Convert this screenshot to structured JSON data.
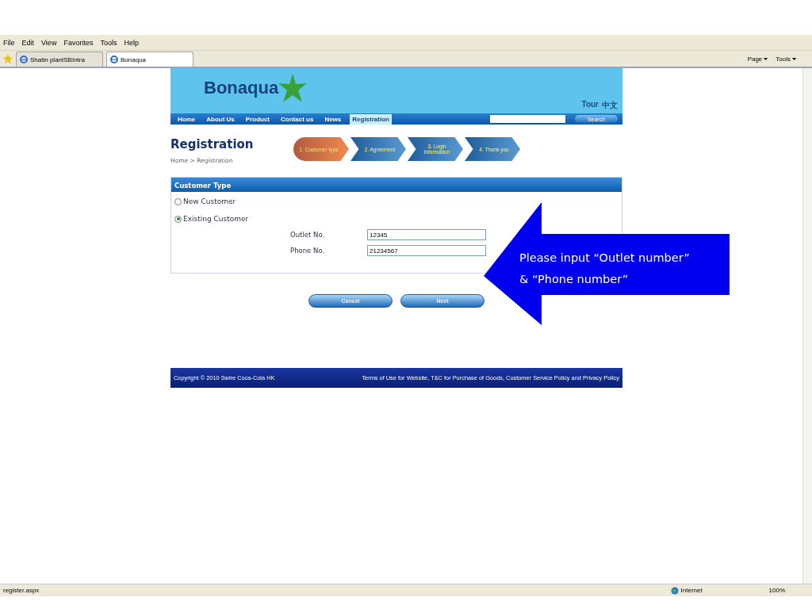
{
  "browser": {
    "menu": [
      "File",
      "Edit",
      "View",
      "Favorites",
      "Tools",
      "Help"
    ],
    "tabs": [
      {
        "label": "Shatin plantSBIntra",
        "selected": false
      },
      {
        "label": "Bonaqua",
        "selected": true
      }
    ],
    "tools": [
      "Page",
      "Tools"
    ]
  },
  "site": {
    "logo": "Bonaqua",
    "header_links": [
      "Tour",
      "中文"
    ],
    "nav": [
      {
        "label": "Home",
        "selected": false
      },
      {
        "label": "About Us",
        "selected": false
      },
      {
        "label": "Product",
        "selected": false
      },
      {
        "label": "Contact us",
        "selected": false
      },
      {
        "label": "News",
        "selected": false
      },
      {
        "label": "Registration",
        "selected": true
      }
    ],
    "search_button": "Search",
    "title": "Registration",
    "breadcrumb": "Home > Registration",
    "steps": [
      {
        "label": "1. Customer type",
        "selected": true
      },
      {
        "label": "2. Agreement",
        "selected": false
      },
      {
        "label": "3. Login information",
        "selected": false
      },
      {
        "label": "4. Thank you",
        "selected": false
      }
    ],
    "panel": {
      "title": "Customer Type",
      "options": [
        {
          "label": "New Customer",
          "selected": false
        },
        {
          "label": "Existing Customer",
          "selected": true
        }
      ],
      "fields": [
        {
          "label": "Outlet No.",
          "value": "12345"
        },
        {
          "label": "Phone No.",
          "value": "21234567"
        }
      ]
    },
    "buttons": [
      "Cancel",
      "Next"
    ],
    "footer": {
      "copyright": "Copyright © 2010 Swire Coca-Cola HK",
      "links": "Terms of Use for Website, T&C for Purchase of Goods, Customer Service Policy and Privacy Policy"
    }
  },
  "status_bar": {
    "url": "register.aspx",
    "zone": "Internet",
    "zoom": "100%"
  },
  "callout": {
    "lines": [
      "Please input “Outlet number”",
      "& “Phone number”"
    ]
  }
}
